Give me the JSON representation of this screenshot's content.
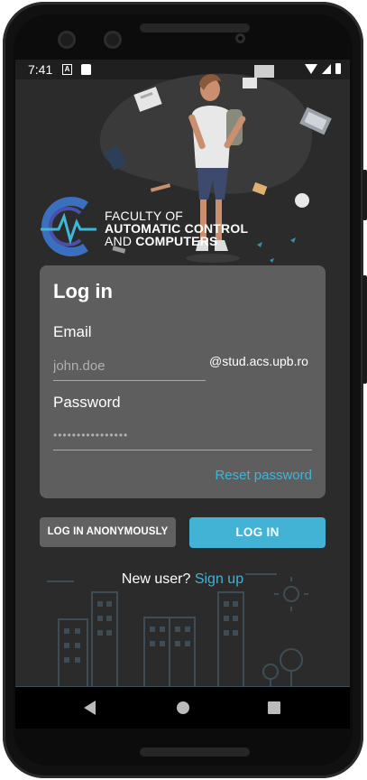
{
  "status_bar": {
    "time": "7:41",
    "icons": [
      "a-icon",
      "sd-card-icon",
      "wifi-icon",
      "signal-icon",
      "battery-icon"
    ]
  },
  "branding": {
    "line1": "FACULTY OF",
    "line2": "AUTOMATIC CONTROL",
    "line3_prefix": "AND ",
    "line3_bold": "COMPUTERS"
  },
  "login_card": {
    "title": "Log in",
    "email_label": "Email",
    "email_placeholder": "john.doe",
    "email_domain": "@stud.acs.upb.ro",
    "password_label": "Password",
    "password_placeholder": "••••••••••••••••",
    "reset_password": "Reset password"
  },
  "buttons": {
    "anonymous": "LOG IN ANONYMOUSLY",
    "login": "LOG IN"
  },
  "signup": {
    "prompt": "New user? ",
    "link": "Sign up"
  },
  "colors": {
    "accent": "#42b3d5",
    "card": "#5e5e5e",
    "background": "#2b2b2b"
  }
}
